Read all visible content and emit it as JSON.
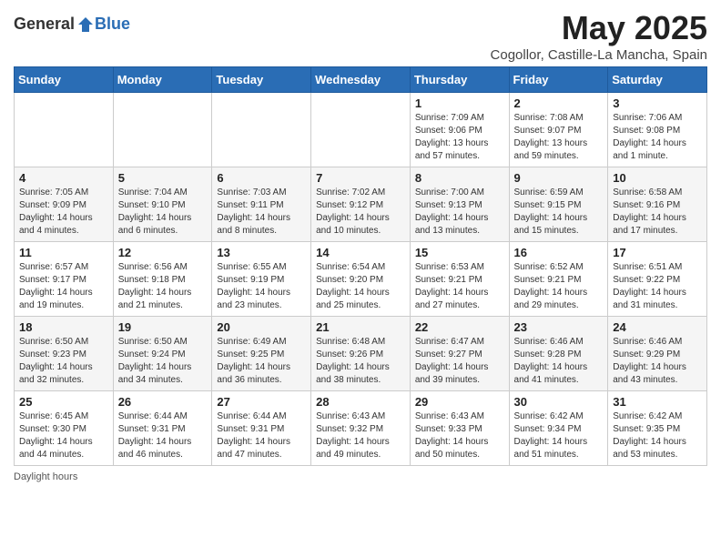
{
  "header": {
    "logo_general": "General",
    "logo_blue": "Blue",
    "title": "May 2025",
    "location": "Cogollor, Castille-La Mancha, Spain"
  },
  "days_of_week": [
    "Sunday",
    "Monday",
    "Tuesday",
    "Wednesday",
    "Thursday",
    "Friday",
    "Saturday"
  ],
  "weeks": [
    [
      {
        "day": "",
        "info": ""
      },
      {
        "day": "",
        "info": ""
      },
      {
        "day": "",
        "info": ""
      },
      {
        "day": "",
        "info": ""
      },
      {
        "day": "1",
        "info": "Sunrise: 7:09 AM\nSunset: 9:06 PM\nDaylight: 13 hours and 57 minutes."
      },
      {
        "day": "2",
        "info": "Sunrise: 7:08 AM\nSunset: 9:07 PM\nDaylight: 13 hours and 59 minutes."
      },
      {
        "day": "3",
        "info": "Sunrise: 7:06 AM\nSunset: 9:08 PM\nDaylight: 14 hours and 1 minute."
      }
    ],
    [
      {
        "day": "4",
        "info": "Sunrise: 7:05 AM\nSunset: 9:09 PM\nDaylight: 14 hours and 4 minutes."
      },
      {
        "day": "5",
        "info": "Sunrise: 7:04 AM\nSunset: 9:10 PM\nDaylight: 14 hours and 6 minutes."
      },
      {
        "day": "6",
        "info": "Sunrise: 7:03 AM\nSunset: 9:11 PM\nDaylight: 14 hours and 8 minutes."
      },
      {
        "day": "7",
        "info": "Sunrise: 7:02 AM\nSunset: 9:12 PM\nDaylight: 14 hours and 10 minutes."
      },
      {
        "day": "8",
        "info": "Sunrise: 7:00 AM\nSunset: 9:13 PM\nDaylight: 14 hours and 13 minutes."
      },
      {
        "day": "9",
        "info": "Sunrise: 6:59 AM\nSunset: 9:15 PM\nDaylight: 14 hours and 15 minutes."
      },
      {
        "day": "10",
        "info": "Sunrise: 6:58 AM\nSunset: 9:16 PM\nDaylight: 14 hours and 17 minutes."
      }
    ],
    [
      {
        "day": "11",
        "info": "Sunrise: 6:57 AM\nSunset: 9:17 PM\nDaylight: 14 hours and 19 minutes."
      },
      {
        "day": "12",
        "info": "Sunrise: 6:56 AM\nSunset: 9:18 PM\nDaylight: 14 hours and 21 minutes."
      },
      {
        "day": "13",
        "info": "Sunrise: 6:55 AM\nSunset: 9:19 PM\nDaylight: 14 hours and 23 minutes."
      },
      {
        "day": "14",
        "info": "Sunrise: 6:54 AM\nSunset: 9:20 PM\nDaylight: 14 hours and 25 minutes."
      },
      {
        "day": "15",
        "info": "Sunrise: 6:53 AM\nSunset: 9:21 PM\nDaylight: 14 hours and 27 minutes."
      },
      {
        "day": "16",
        "info": "Sunrise: 6:52 AM\nSunset: 9:21 PM\nDaylight: 14 hours and 29 minutes."
      },
      {
        "day": "17",
        "info": "Sunrise: 6:51 AM\nSunset: 9:22 PM\nDaylight: 14 hours and 31 minutes."
      }
    ],
    [
      {
        "day": "18",
        "info": "Sunrise: 6:50 AM\nSunset: 9:23 PM\nDaylight: 14 hours and 32 minutes."
      },
      {
        "day": "19",
        "info": "Sunrise: 6:50 AM\nSunset: 9:24 PM\nDaylight: 14 hours and 34 minutes."
      },
      {
        "day": "20",
        "info": "Sunrise: 6:49 AM\nSunset: 9:25 PM\nDaylight: 14 hours and 36 minutes."
      },
      {
        "day": "21",
        "info": "Sunrise: 6:48 AM\nSunset: 9:26 PM\nDaylight: 14 hours and 38 minutes."
      },
      {
        "day": "22",
        "info": "Sunrise: 6:47 AM\nSunset: 9:27 PM\nDaylight: 14 hours and 39 minutes."
      },
      {
        "day": "23",
        "info": "Sunrise: 6:46 AM\nSunset: 9:28 PM\nDaylight: 14 hours and 41 minutes."
      },
      {
        "day": "24",
        "info": "Sunrise: 6:46 AM\nSunset: 9:29 PM\nDaylight: 14 hours and 43 minutes."
      }
    ],
    [
      {
        "day": "25",
        "info": "Sunrise: 6:45 AM\nSunset: 9:30 PM\nDaylight: 14 hours and 44 minutes."
      },
      {
        "day": "26",
        "info": "Sunrise: 6:44 AM\nSunset: 9:31 PM\nDaylight: 14 hours and 46 minutes."
      },
      {
        "day": "27",
        "info": "Sunrise: 6:44 AM\nSunset: 9:31 PM\nDaylight: 14 hours and 47 minutes."
      },
      {
        "day": "28",
        "info": "Sunrise: 6:43 AM\nSunset: 9:32 PM\nDaylight: 14 hours and 49 minutes."
      },
      {
        "day": "29",
        "info": "Sunrise: 6:43 AM\nSunset: 9:33 PM\nDaylight: 14 hours and 50 minutes."
      },
      {
        "day": "30",
        "info": "Sunrise: 6:42 AM\nSunset: 9:34 PM\nDaylight: 14 hours and 51 minutes."
      },
      {
        "day": "31",
        "info": "Sunrise: 6:42 AM\nSunset: 9:35 PM\nDaylight: 14 hours and 53 minutes."
      }
    ]
  ],
  "footer": {
    "note": "Daylight hours"
  }
}
